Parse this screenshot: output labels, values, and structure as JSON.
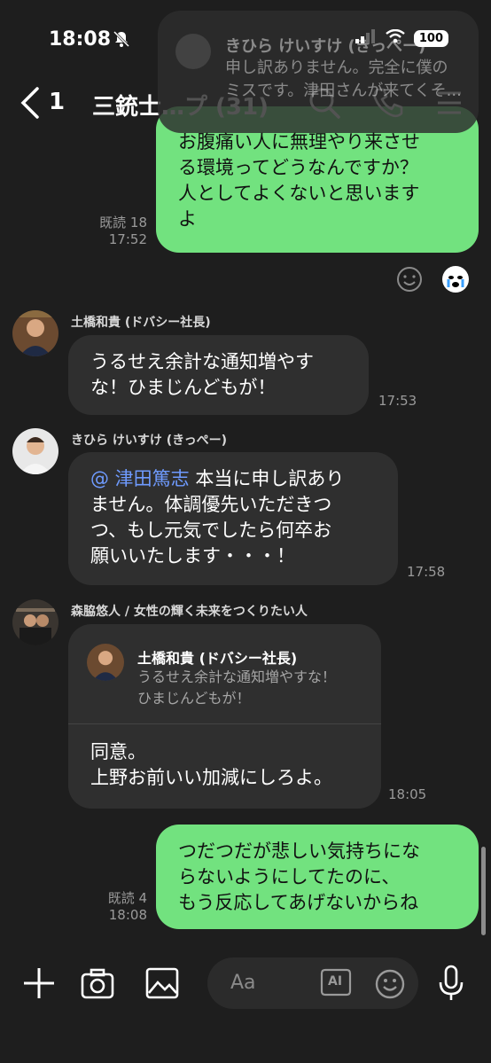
{
  "status": {
    "time": "18:08",
    "battery": "100"
  },
  "notification": {
    "sender": "きひら けいすけ (きっぺー)",
    "text_line1": "申し訳ありません。完全に僕の",
    "text_line2": "ミスです。津田さんが来てくそ..."
  },
  "header": {
    "back_count": "1",
    "title": "三銃士…プ (31)"
  },
  "messages": [
    {
      "id": "m1",
      "side": "mine",
      "lines": [
        "お腹痛い人に無理やり来させ",
        "る環境ってどうなんですか？",
        "人としてよくないと思います",
        "よ"
      ],
      "read": "既読 18",
      "time": "17:52"
    },
    {
      "id": "m2",
      "side": "theirs",
      "sender": "土橋和貴 (ドバシー社長)",
      "lines": [
        "うるせえ余計な通知増やす",
        "な！ひまじんどもが！"
      ],
      "time": "17:53"
    },
    {
      "id": "m3",
      "side": "theirs",
      "sender": "きひら けいすけ (きっぺー)",
      "mention": "@ 津田篤志",
      "first_line_rest": " 本当に申し訳あり",
      "lines": [
        "ません。体調優先いただきつ",
        "つ、もし元気でしたら何卒お",
        "願いいたします・・・！"
      ],
      "time": "17:58"
    },
    {
      "id": "m4",
      "side": "theirs",
      "sender": "森脇悠人 / 女性の輝く未来をつくりたい人",
      "quote_sender": "土橋和貴 (ドバシー社長)",
      "quote_lines": [
        "うるせえ余計な通知増やすな！",
        "ひまじんどもが！"
      ],
      "lines": [
        "同意。",
        "上野お前いい加減にしろよ。"
      ],
      "time": "18:05"
    },
    {
      "id": "m5",
      "side": "mine",
      "lines": [
        "つだつだが悲しい気持ちにな",
        "らないようにしてたのに、",
        "もう反応してあげないからね"
      ],
      "read": "既読 4",
      "time": "18:08"
    }
  ],
  "input": {
    "placeholder": "Aa",
    "ai_label": "AI"
  },
  "icons": [
    "bell-slash-icon",
    "signal-icon",
    "wifi-icon",
    "battery-icon",
    "back-icon",
    "search-icon",
    "phone-icon",
    "menu-icon",
    "smiley-reaction-icon",
    "crying-sticker-icon",
    "plus-icon",
    "camera-icon",
    "image-icon",
    "ai-icon",
    "emoji-icon",
    "mic-icon"
  ]
}
